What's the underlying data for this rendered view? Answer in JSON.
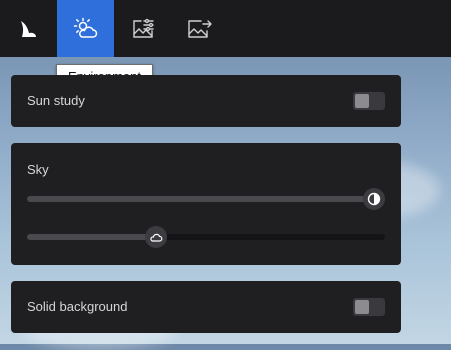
{
  "toolbar": {
    "items": [
      {
        "icon": "logo-icon",
        "active": false
      },
      {
        "icon": "environment-icon",
        "active": true
      },
      {
        "icon": "image-settings-icon",
        "active": false
      },
      {
        "icon": "export-image-icon",
        "active": false
      }
    ],
    "active_color": "#2f6fdb"
  },
  "tooltip": {
    "text": "Environment"
  },
  "sun_study": {
    "label": "Sun study",
    "enabled": false
  },
  "sky": {
    "label": "Sky",
    "brightness": {
      "icon": "contrast-icon",
      "level": 0.97
    },
    "cloudiness": {
      "icon": "cloud-icon",
      "level": 0.36
    }
  },
  "solid_background": {
    "label": "Solid background",
    "enabled": false
  }
}
